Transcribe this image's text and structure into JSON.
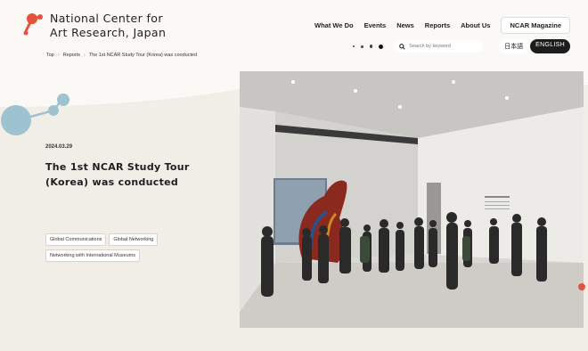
{
  "brand": {
    "line1": "National Center for",
    "line2": "Art Research, Japan"
  },
  "nav": {
    "items": [
      "What We Do",
      "Events",
      "News",
      "Reports",
      "About Us"
    ],
    "magazine": "NCAR Magazine"
  },
  "search": {
    "placeholder": "Search by keyword"
  },
  "lang": {
    "jp": "日本語",
    "en": "ENGLISH"
  },
  "breadcrumb": {
    "top": "Top",
    "reports": "Reports",
    "current": "The 1st NCAR Study Tour (Korea) was conducted"
  },
  "article": {
    "date": "2024.03.29",
    "title": "The 1st NCAR Study Tour (Korea) was conducted",
    "tags": [
      "Global Communications",
      "Global Networking",
      "Networking with International Museums"
    ]
  },
  "colors": {
    "accent": "#e6513c",
    "bubble": "#9fc2d0",
    "background": "#f1ede7"
  },
  "icons": {
    "logo": "red-molecule-logo",
    "search": "search-icon",
    "decoration": "blue-bubbles"
  }
}
